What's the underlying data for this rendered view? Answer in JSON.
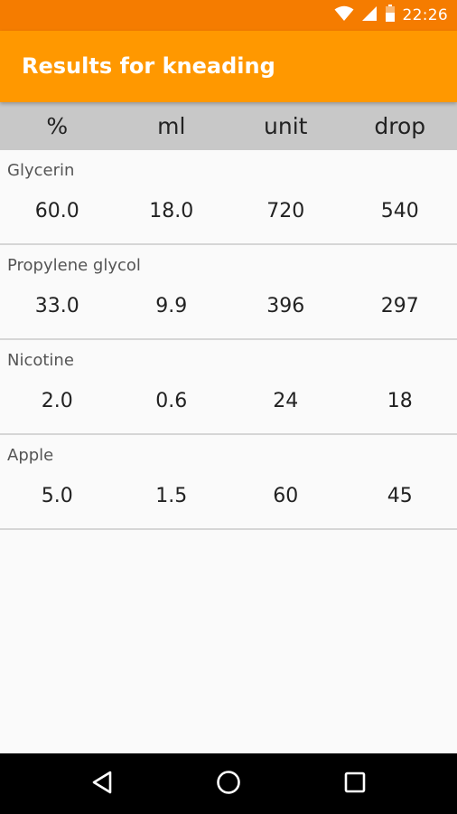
{
  "status_bar": {
    "time": "22:26",
    "icons": [
      "wifi-icon",
      "cell-signal-icon",
      "battery-icon"
    ]
  },
  "app_bar": {
    "title": "Results for kneading"
  },
  "table": {
    "headers": [
      "%",
      "ml",
      "unit",
      "drop"
    ],
    "rows": [
      {
        "name": "Glycerin",
        "values": [
          "60.0",
          "18.0",
          "720",
          "540"
        ]
      },
      {
        "name": "Propylene glycol",
        "values": [
          "33.0",
          "9.9",
          "396",
          "297"
        ]
      },
      {
        "name": "Nicotine",
        "values": [
          "2.0",
          "0.6",
          "24",
          "18"
        ]
      },
      {
        "name": "Apple",
        "values": [
          "5.0",
          "1.5",
          "60",
          "45"
        ]
      }
    ]
  },
  "nav_bar": {
    "icons": [
      "back-icon",
      "home-icon",
      "recents-icon"
    ]
  },
  "colors": {
    "status_bar": "#f57c00",
    "app_bar": "#ff9800",
    "header_bg": "#c8c8c8",
    "background": "#fafafa"
  }
}
